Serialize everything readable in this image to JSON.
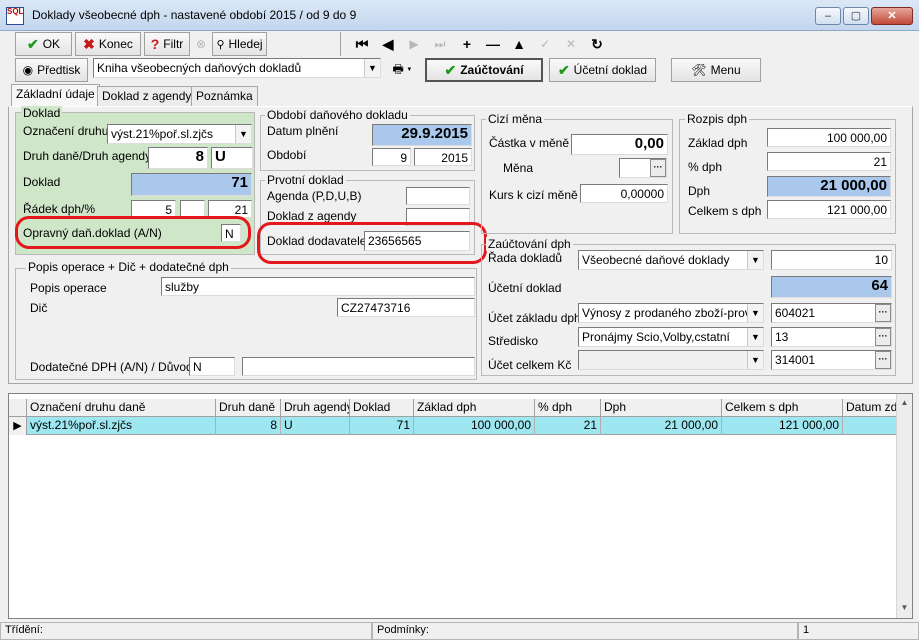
{
  "window": {
    "icon_text": "SQL",
    "title": "Doklady všeobecné dph - nastavené období 2015 / od 9 do 9",
    "min": "–",
    "max": "▢",
    "close": "✕"
  },
  "toolbar": {
    "ok": "OK",
    "konec": "Konec",
    "filtr": "Filtr",
    "hledej": "Hledej"
  },
  "toolbar2": {
    "predtisk": "Předtisk",
    "kniha": "Kniha všeobecných daňových dokladů",
    "zauctovani": "Zaúčtování",
    "ucetni_doklad": "Účetní doklad",
    "menu": "Menu"
  },
  "tabs": [
    "Základní údaje",
    "Doklad z agendy",
    "Poznámka"
  ],
  "doklad": {
    "title": "Doklad",
    "oznaceni_label": "Označení druhu",
    "oznaceni_value": "výst.21%poř.sl.zjčs",
    "druh_label": "Druh daně/Druh agendy",
    "druh_dane": "8",
    "druh_agendy": "U",
    "doklad_label": "Doklad",
    "doklad_value": "71",
    "radek_label": "Řádek dph/%",
    "radek_1": "5",
    "radek_2": "",
    "radek_3": "21",
    "opravny_label": "Opravný daň.doklad (A/N)",
    "opravny_value": "N"
  },
  "obdobi": {
    "title": "Období daňového dokladu",
    "datum_label": "Datum plnění",
    "datum_value": "29.9.2015",
    "obdobi_label": "Období",
    "obdobi_mesic": "9",
    "obdobi_rok": "2015"
  },
  "prvotni": {
    "title": "Prvotní doklad",
    "agenda_label": "Agenda (P,D,U,B)",
    "agenda_value": "",
    "zagendy_label": "Doklad z agendy",
    "zagendy_value": "",
    "dodavatele_label": "Doklad dodavatele",
    "dodavatele_value": "23656565"
  },
  "cizi_mena": {
    "title": "Cizí měna",
    "castka_label": "Částka v měně",
    "castka_value": "0,00",
    "mena_label": "Měna",
    "mena_value": "",
    "kurs_label": "Kurs k cizí měně",
    "kurs_value": "0,00000"
  },
  "rozpis": {
    "title": "Rozpis dph",
    "zaklad_label": "Základ dph",
    "zaklad_value": "100 000,00",
    "pct_label": "% dph",
    "pct_value": "21",
    "dph_label": "Dph",
    "dph_value": "21 000,00",
    "celkem_label": "Celkem s dph",
    "celkem_value": "121 000,00"
  },
  "popis": {
    "title": "Popis operace + Dič + dodatečné dph",
    "popis_label": "Popis operace",
    "popis_value": "služby",
    "dic_label": "Dič",
    "dic_value": "CZ27473716",
    "dodatecne_label": "Dodatečné DPH (A/N) / Důvod",
    "dodatecne_value": "N",
    "duvod_value": ""
  },
  "zauctovani": {
    "title": "Zaúčtování dph",
    "rada_label": "Řada dokladů",
    "rada_value": "Všeobecné daňové doklady",
    "rada_num": "10",
    "ucetni_label": "Účetní doklad",
    "ucetni_value": "64",
    "ucet_zakladu_label": "Účet základu dph",
    "ucet_zakladu_value": "Výnosy z prodaného zboží-provozo",
    "ucet_zakladu_num": "604021",
    "stredisko_label": "Středisko",
    "stredisko_value": "Pronájmy Scio,Volby,cstatní",
    "stredisko_num": "13",
    "ucet_celkem_label": "Účet celkem Kč",
    "ucet_celkem_value": "",
    "ucet_celkem_num": "314001"
  },
  "grid": {
    "columns": [
      "Označení druhu daně",
      "Druh daně",
      "Druh agendy",
      "Doklad",
      "Základ dph",
      "% dph",
      "Dph",
      "Celkem s dph",
      "Datum zda"
    ],
    "rows": [
      [
        "výst.21%poř.sl.zjčs",
        "8",
        "U",
        "71",
        "100 000,00",
        "21",
        "21 000,00",
        "121 000,00",
        ""
      ]
    ]
  },
  "status": {
    "trideni": "Třídění:",
    "podminky": "Podmínky:",
    "count": "1"
  },
  "colors": {
    "highlight_blue": "#a9c8ec",
    "green_panel": "#cfe6c9",
    "red_annotation": "#e3171c",
    "selected_row": "#9ee7f1"
  }
}
